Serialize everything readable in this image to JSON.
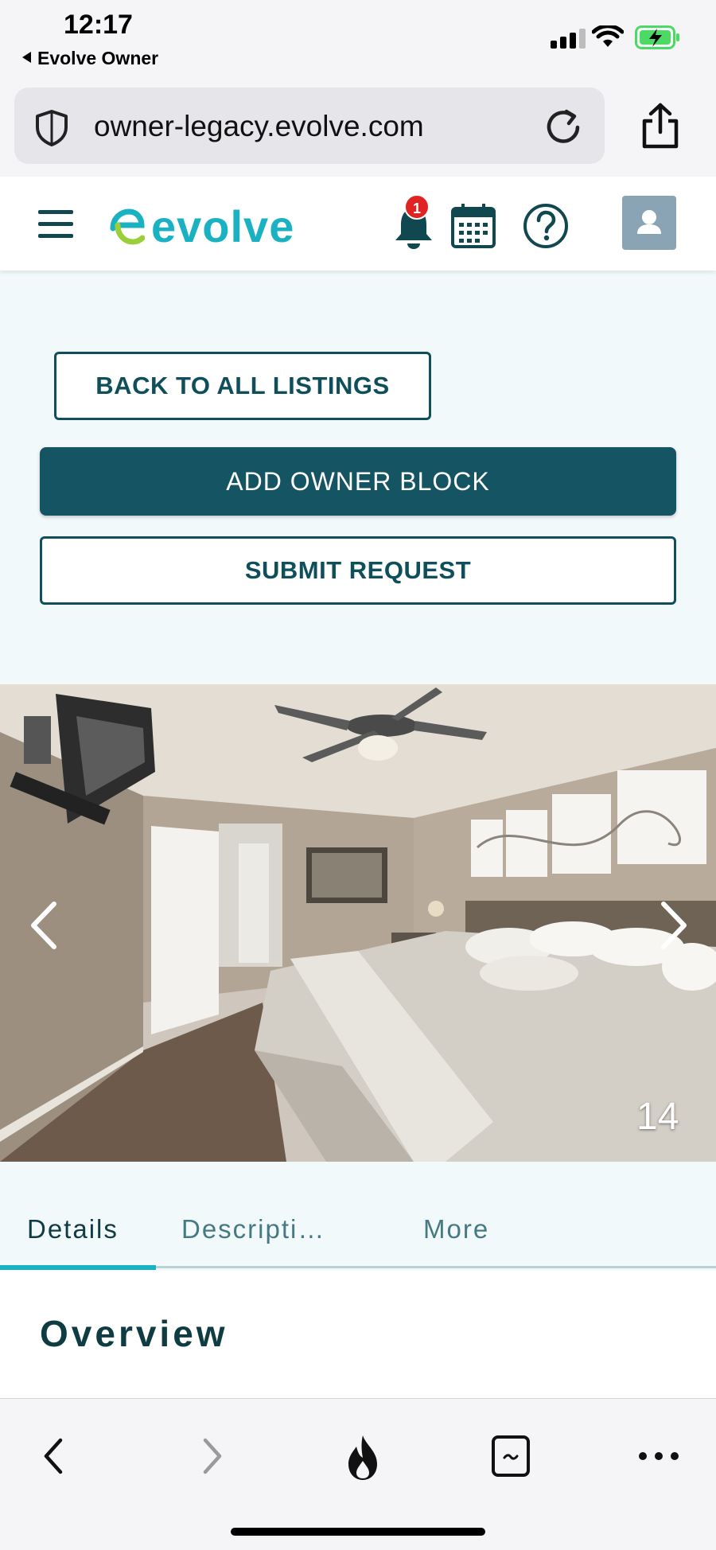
{
  "status_bar": {
    "time": "12:17",
    "back_app": "Evolve Owner"
  },
  "browser": {
    "url": "owner-legacy.evolve.com"
  },
  "header": {
    "logo_text": "evolve",
    "notification_count": "1"
  },
  "actions": {
    "back_label": "BACK TO ALL LISTINGS",
    "add_block_label": "ADD OWNER BLOCK",
    "submit_label": "SUBMIT REQUEST"
  },
  "gallery": {
    "counter": "14"
  },
  "tabs": [
    {
      "label": "Details",
      "active": true
    },
    {
      "label": "Descripti…",
      "active": false
    },
    {
      "label": "More",
      "active": false
    }
  ],
  "overview": {
    "title": "Overview"
  },
  "colors": {
    "brand_teal": "#155563",
    "logo_cyan": "#1ab2c2",
    "logo_green": "#9bcf3a",
    "badge_red": "#e02424"
  }
}
